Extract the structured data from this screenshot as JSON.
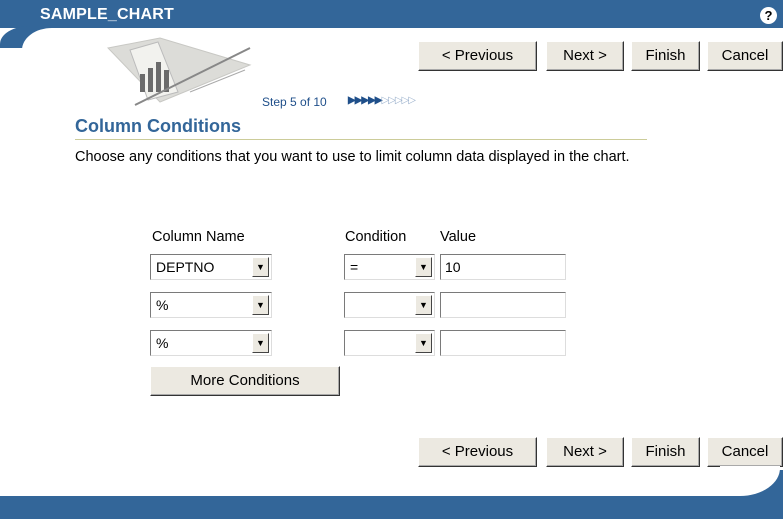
{
  "header": {
    "title": "SAMPLE_CHART",
    "help_icon": "?"
  },
  "nav": {
    "previous": "< Previous",
    "next": "Next >",
    "finish": "Finish",
    "cancel": "Cancel"
  },
  "step": {
    "text": "Step 5 of 10",
    "current": 5,
    "total": 10
  },
  "section": {
    "title": "Column Conditions",
    "description": "Choose any conditions that you want to use to limit column data displayed in the chart."
  },
  "columns": {
    "name": "Column Name",
    "condition": "Condition",
    "value": "Value"
  },
  "rows": [
    {
      "column": "DEPTNO",
      "condition": "=",
      "value": "10"
    },
    {
      "column": "%",
      "condition": "",
      "value": ""
    },
    {
      "column": "%",
      "condition": "",
      "value": ""
    }
  ],
  "more_conditions": "More Conditions",
  "colors": {
    "brand": "#336699",
    "button": "#ece9e1"
  }
}
